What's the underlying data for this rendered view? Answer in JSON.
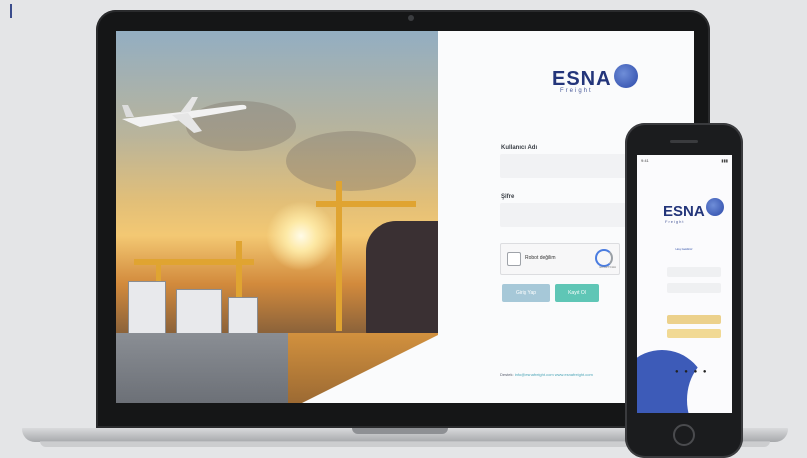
{
  "laptop": {
    "brand": {
      "name": "ESNA",
      "tagline": "Freight"
    },
    "login_form": {
      "username_label": "Kullanıcı Adı",
      "password_label": "Şifre",
      "captcha": {
        "label": "Robot değilim",
        "badge": "reCAPTCHA"
      },
      "login_button": "Giriş Yap",
      "signup_button": "Kayıt Ol"
    },
    "footer": {
      "prefix": "Destek:",
      "link_1": "info@esnafreight.com",
      "link_2": "www.esnafreight.com"
    }
  },
  "phone": {
    "status_time": "9:41",
    "status_right": "▮▮▮",
    "brand": {
      "name": "ESNA",
      "tagline": "Freight"
    },
    "heading": "Hoş Geldiniz",
    "social_icons": "● ● ● ●"
  },
  "colors": {
    "brand_blue": "#23357a",
    "login_button": "#a6c8d8",
    "signup_button": "#5fc6b6",
    "phone_accent": "#ecd18c"
  }
}
